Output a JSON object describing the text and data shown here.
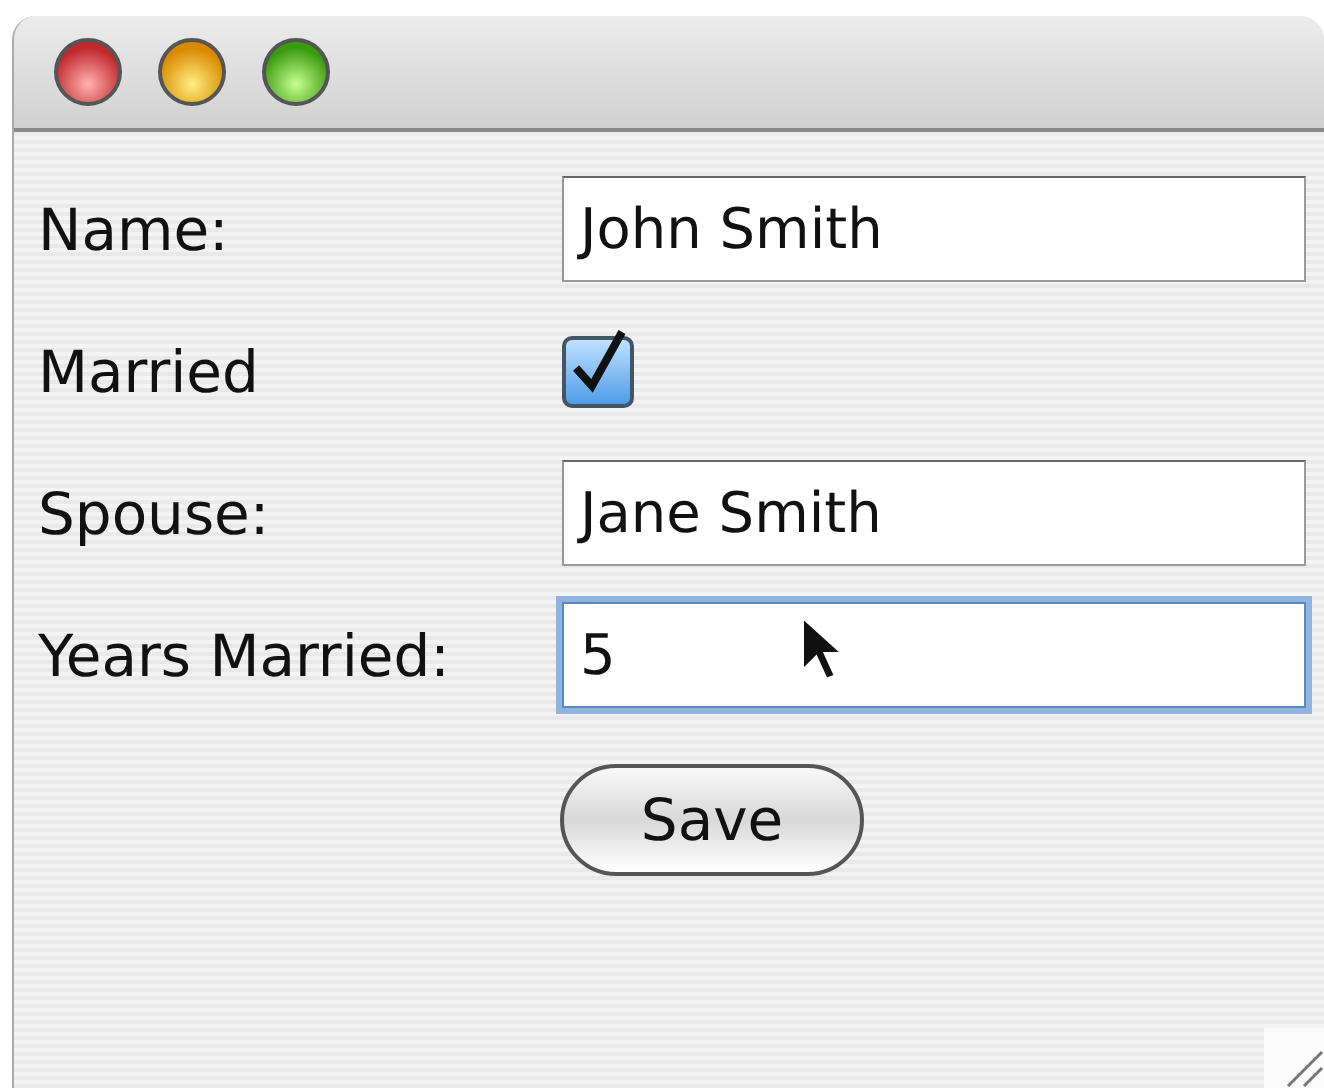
{
  "fields": [
    {
      "kind": "text",
      "label": "Name:",
      "value": "John Smith",
      "focused": false
    },
    {
      "kind": "checkbox",
      "label": "Married",
      "checked": true
    },
    {
      "kind": "text",
      "label": "Spouse:",
      "value": "Jane Smith",
      "focused": false
    },
    {
      "kind": "text",
      "label": "Years Married:",
      "value": "5",
      "focused": true
    }
  ],
  "save_button": {
    "label": "Save"
  }
}
